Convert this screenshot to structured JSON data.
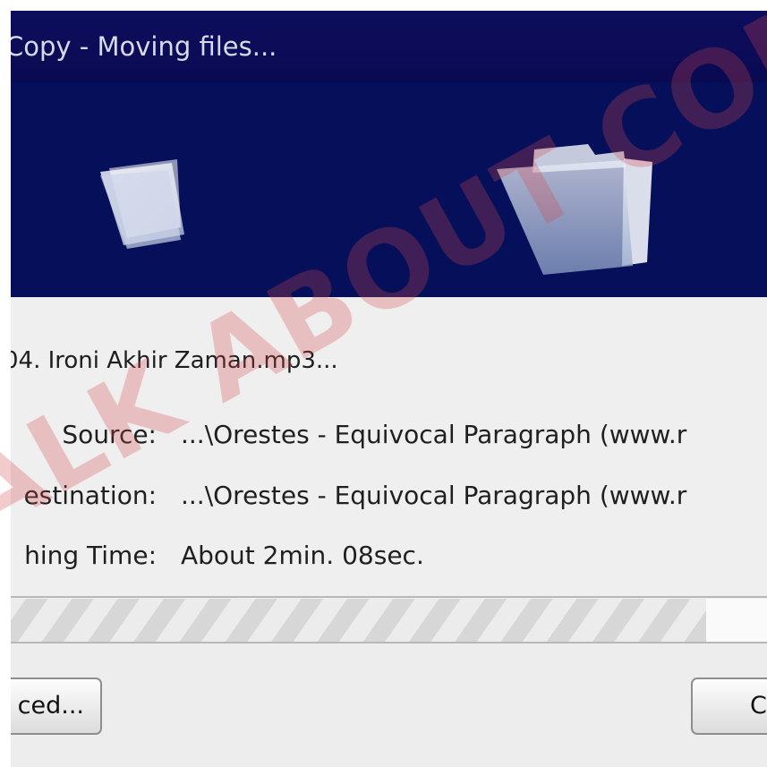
{
  "window": {
    "title": "Copy - Moving files..."
  },
  "status": {
    "current_file": "04. Ironi Akhir Zaman.mp3...",
    "source_label": "Source:",
    "source_value": "...\\Orestes - Equivocal Paragraph (www.r",
    "destination_label": "estination:",
    "destination_value": "...\\Orestes - Equivocal Paragraph (www.r",
    "remaining_label": "hing Time:",
    "remaining_value": "About  2min. 08sec."
  },
  "progress": {
    "fraction": 0.92
  },
  "buttons": {
    "left_label": "ced...",
    "right_label": "C"
  },
  "watermark": {
    "text": "ALK ABOUT COMPUTE"
  },
  "colors": {
    "titlebar": "#0d0d5e",
    "banner": "#06105a",
    "watermark": "#d8454a"
  },
  "icons": {
    "source": "folder-icon",
    "destination": "folder-icon"
  }
}
